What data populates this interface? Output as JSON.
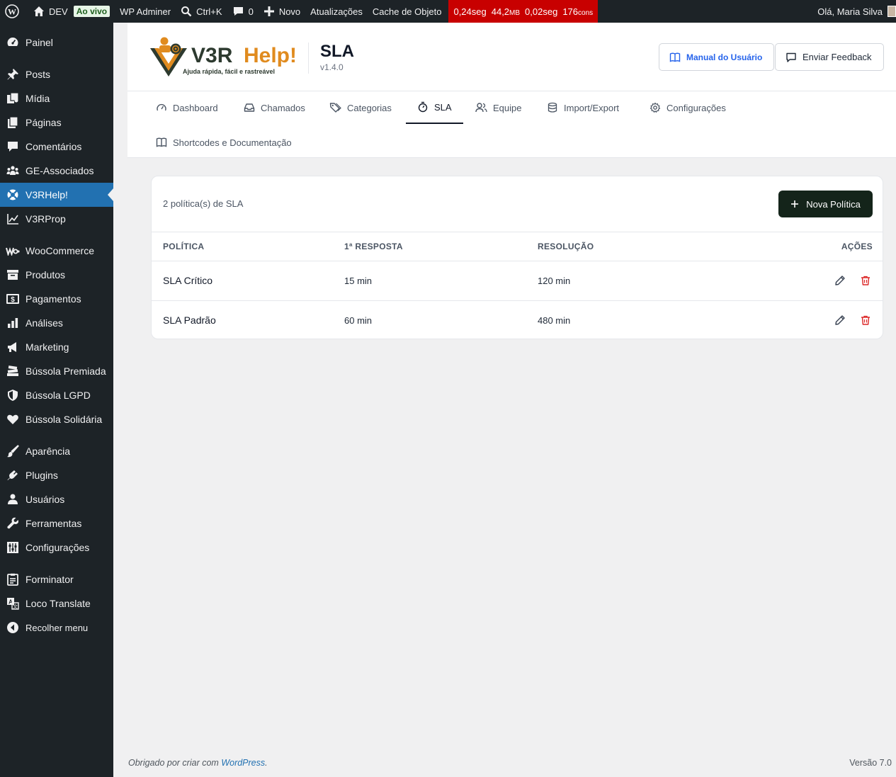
{
  "adminbar": {
    "site": "DEV",
    "live_badge": "Ao vivo",
    "adminer": "WP Adminer",
    "search": "Ctrl+K",
    "comments_count": "0",
    "new": "Novo",
    "updates": "Atualizações",
    "cache": "Cache de Objeto",
    "perf": {
      "time1": "0,24seg",
      "mem": "44,2",
      "mem_unit": "MB",
      "time2": "0,02seg",
      "queries": "176",
      "queries_unit": "cons"
    },
    "greeting": "Olá, Maria Silva"
  },
  "sidebar": {
    "items": [
      {
        "label": "Painel",
        "icon": "dashboard-icon"
      },
      {
        "label": "Posts",
        "icon": "pin-icon"
      },
      {
        "label": "Mídia",
        "icon": "media-icon"
      },
      {
        "label": "Páginas",
        "icon": "pages-icon"
      },
      {
        "label": "Comentários",
        "icon": "comment-icon"
      },
      {
        "label": "GE-Associados",
        "icon": "groups-icon"
      },
      {
        "label": "V3RHelp!",
        "icon": "lifebuoy-icon"
      },
      {
        "label": "V3RProp",
        "icon": "chart-line-icon"
      },
      {
        "label": "WooCommerce",
        "icon": "woocommerce-icon"
      },
      {
        "label": "Produtos",
        "icon": "archive-icon"
      },
      {
        "label": "Pagamentos",
        "icon": "money-icon"
      },
      {
        "label": "Análises",
        "icon": "bar-chart-icon"
      },
      {
        "label": "Marketing",
        "icon": "megaphone-icon"
      },
      {
        "label": "Bússola Premiada",
        "icon": "books-icon"
      },
      {
        "label": "Bússola LGPD",
        "icon": "shield-icon"
      },
      {
        "label": "Bússola Solidária",
        "icon": "heart-icon"
      },
      {
        "label": "Aparência",
        "icon": "brush-icon"
      },
      {
        "label": "Plugins",
        "icon": "plugin-icon"
      },
      {
        "label": "Usuários",
        "icon": "user-icon"
      },
      {
        "label": "Ferramentas",
        "icon": "wrench-icon"
      },
      {
        "label": "Configurações",
        "icon": "settings-sliders-icon"
      },
      {
        "label": "Forminator",
        "icon": "clipboard-icon"
      },
      {
        "label": "Loco Translate",
        "icon": "translate-icon"
      }
    ],
    "collapse": "Recolher menu"
  },
  "header": {
    "logo_name_a": "V3R",
    "logo_name_b": "Help!",
    "logo_tagline": "Ajuda rápida, fácil e rastreável",
    "title": "SLA",
    "version": "v1.4.0",
    "manual_label": "Manual do Usuário",
    "feedback_label": "Enviar Feedback"
  },
  "tabs": [
    {
      "label": "Dashboard",
      "icon": "gauge-icon"
    },
    {
      "label": "Chamados",
      "icon": "inbox-icon"
    },
    {
      "label": "Categorias",
      "icon": "tags-icon"
    },
    {
      "label": "SLA",
      "icon": "timer-icon"
    },
    {
      "label": "Equipe",
      "icon": "users-icon"
    },
    {
      "label": "Import/Export",
      "icon": "database-icon"
    },
    {
      "label": "Configurações",
      "icon": "gear-icon"
    },
    {
      "label": "Shortcodes e Documentação",
      "icon": "book-open-icon"
    }
  ],
  "sla": {
    "count_text": "2 política(s) de SLA",
    "new_button": "Nova Política",
    "columns": [
      "POLÍTICA",
      "1ª RESPOSTA",
      "RESOLUÇÃO",
      "AÇÕES"
    ],
    "rows": [
      {
        "name": "SLA Crítico",
        "first_response": "15 min",
        "resolution": "120 min"
      },
      {
        "name": "SLA Padrão",
        "first_response": "60 min",
        "resolution": "480 min"
      }
    ]
  },
  "footer": {
    "thanks": "Obrigado por criar com ",
    "link": "WordPress",
    "period": ".",
    "version": "Versão 7.0"
  },
  "colors": {
    "admin_bg": "#1d2327",
    "active_menu": "#2271b1",
    "perf_bg": "#c80000",
    "primary_button": "#14241a",
    "delete_red": "#dc2626",
    "logo_orange": "#e08b1f"
  }
}
